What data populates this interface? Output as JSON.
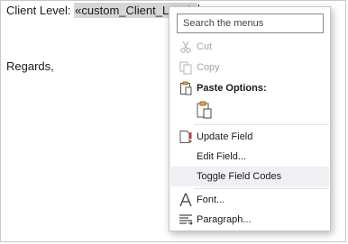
{
  "document": {
    "client_level_label": "Client Level: ",
    "client_level_field": "«custom_Client_Level»",
    "regards": "Regards,"
  },
  "context_menu": {
    "search_placeholder": "Search the menus",
    "cut": "Cut",
    "copy": "Copy",
    "paste_options": "Paste Options:",
    "update_field": "Update Field",
    "edit_field": "Edit Field...",
    "toggle_field_codes": "Toggle Field Codes",
    "font": "Font...",
    "paragraph": "Paragraph..."
  },
  "colors": {
    "field_highlight": "#d6d6d6",
    "disabled_text": "#a6a6a6",
    "hover_row": "#eef0f3",
    "alert_red": "#d13438"
  }
}
